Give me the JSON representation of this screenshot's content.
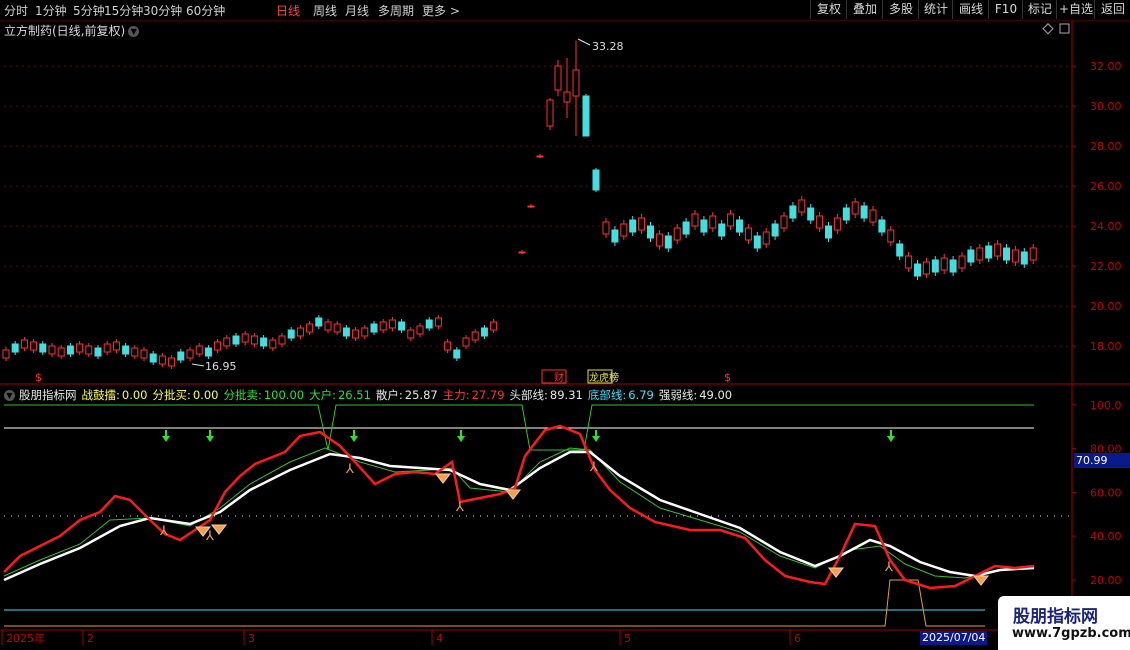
{
  "toolbar": {
    "tabs": [
      "分时",
      "1分钟",
      "5分钟",
      "15分钟",
      "30分钟",
      "60分钟",
      "日线",
      "周线",
      "月线",
      "多周期",
      "更多 >"
    ],
    "active_tab": "日线",
    "right_buttons": [
      "复权",
      "叠加",
      "多股",
      "统计",
      "画线",
      "F10",
      "标记",
      "+自选",
      "返回"
    ]
  },
  "stock_title": "立方制药(日线,前复权)",
  "price_axis": {
    "ticks": [
      "32.00",
      "30.00",
      "28.00",
      "26.00",
      "24.00",
      "22.00",
      "20.00",
      "18.00"
    ]
  },
  "annotations": {
    "high": "33.28",
    "low": "16.95",
    "event_cw": "财",
    "event_lhb": "龙虎榜",
    "dollar": "$"
  },
  "indicator": {
    "name": "股朋指标网",
    "fields": [
      {
        "label": "战鼓擂:",
        "value": "0.00",
        "color": "#ffff40"
      },
      {
        "label": "分批买:",
        "value": "0.00",
        "color": "#ffff40"
      },
      {
        "label": "分批卖:",
        "value": "100.00",
        "color": "#30e030"
      },
      {
        "label": "大户:",
        "value": "26.51",
        "color": "#30e030"
      },
      {
        "label": "散户:",
        "value": "25.87",
        "color": "#e8e8e8"
      },
      {
        "label": "主力:",
        "value": "27.79",
        "color": "#ff3030"
      },
      {
        "label": "头部线:",
        "value": "89.31",
        "color": "#e8e8e8"
      },
      {
        "label": "底部线:",
        "value": "6.79",
        "color": "#40e0ff"
      },
      {
        "label": "强弱线:",
        "value": "49.00",
        "color": "#e8e8e8"
      }
    ],
    "axis_ticks": [
      "100.0",
      "80.00",
      "60.00",
      "40.00",
      "20.00"
    ],
    "current_value": "70.99"
  },
  "time_axis": {
    "labels": [
      "2025年",
      "2",
      "3",
      "4",
      "5",
      "6"
    ],
    "current_date": "2025/07/04"
  },
  "watermark": {
    "title": "股朋指标网",
    "url": "www.7gpzb.com"
  },
  "colors": {
    "up": "#ff3030",
    "down": "#40e0e0",
    "grid": "#6a0000",
    "axis": "#a00000"
  }
}
